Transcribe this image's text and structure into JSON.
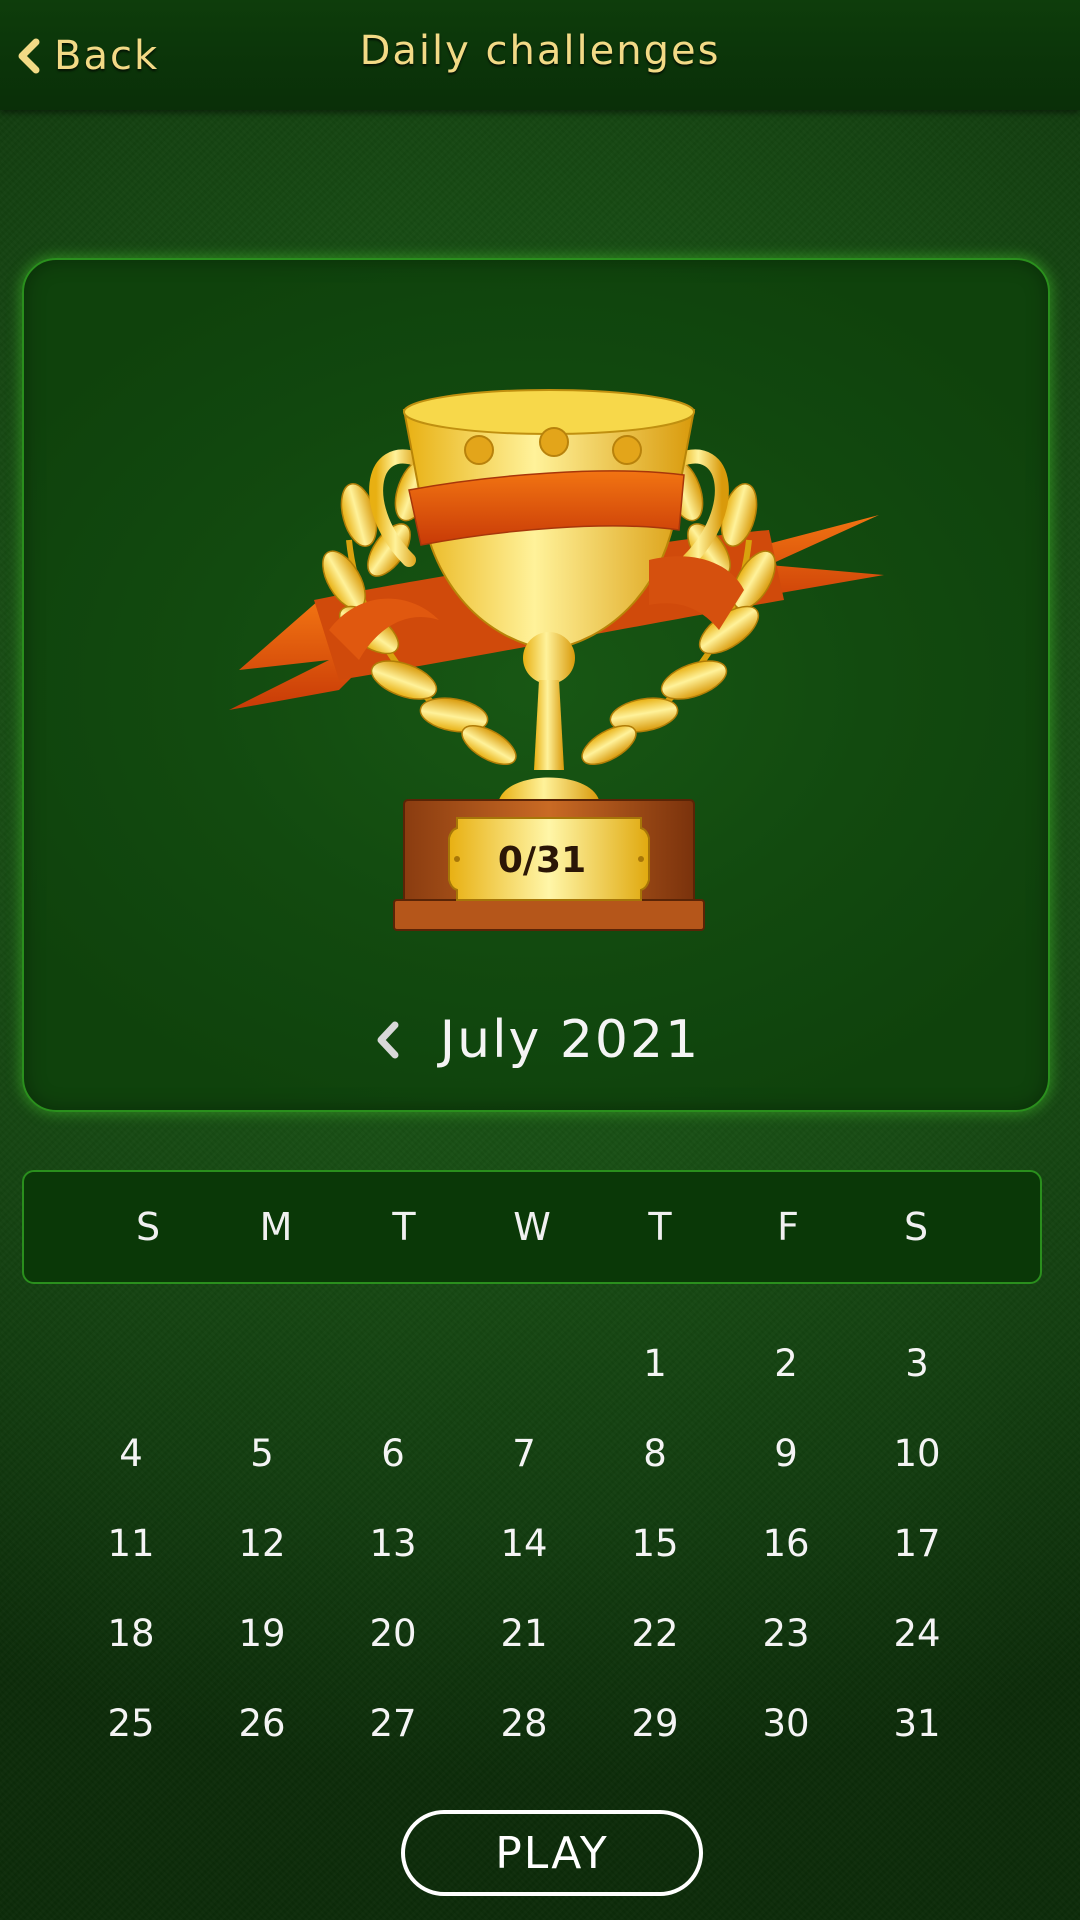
{
  "header": {
    "back_label": "Back",
    "title": "Daily challenges"
  },
  "trophy": {
    "progress": "0/31"
  },
  "month_nav": {
    "month_label": "July 2021"
  },
  "weekdays": [
    "S",
    "M",
    "T",
    "W",
    "T",
    "F",
    "S"
  ],
  "calendar": {
    "first_weekday_index": 4,
    "days": [
      "1",
      "2",
      "3",
      "4",
      "5",
      "6",
      "7",
      "8",
      "9",
      "10",
      "11",
      "12",
      "13",
      "14",
      "15",
      "16",
      "17",
      "18",
      "19",
      "20",
      "21",
      "22",
      "23",
      "24",
      "25",
      "26",
      "27",
      "28",
      "29",
      "30",
      "31"
    ]
  },
  "play_label": "PLAY",
  "colors": {
    "background": "#184f14",
    "header": "#0b3409",
    "accent_gold": "#f2da86",
    "panel_border": "#2a8f1d",
    "ribbon": "#e0520e"
  },
  "icons": {
    "back": "chevron-left-icon",
    "prev_month": "chevron-left-icon",
    "trophy": "trophy-icon"
  }
}
